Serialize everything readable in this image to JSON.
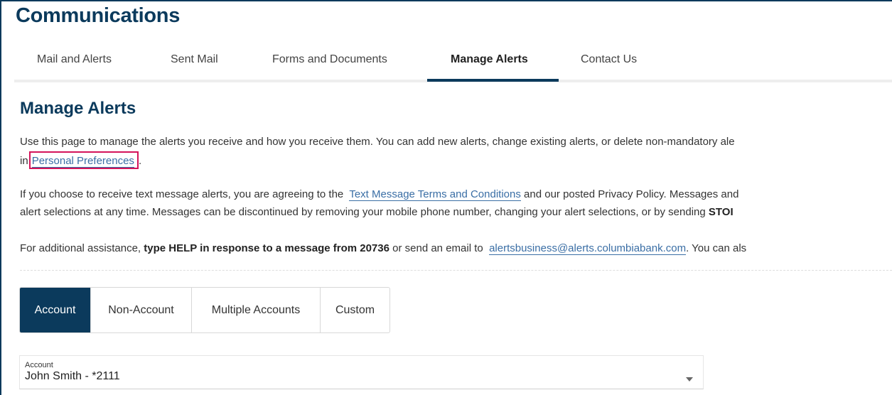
{
  "header": {
    "title": "Communications"
  },
  "tabs": [
    {
      "label": "Mail and Alerts"
    },
    {
      "label": "Sent Mail"
    },
    {
      "label": "Forms and Documents"
    },
    {
      "label": "Manage Alerts"
    },
    {
      "label": "Contact Us"
    }
  ],
  "active_tab": "Manage Alerts",
  "page": {
    "title": "Manage Alerts",
    "intro": "Use this page to manage the alerts you receive and how you receive them. You can add new alerts, change existing alerts, or delete non-mandatory ale",
    "intro_prefix": "in",
    "personal_preferences_link": "Personal Preferences",
    "intro_suffix": ".",
    "sms_pre": "If you choose to receive text message alerts, you are agreeing to the",
    "sms_terms_link": "Text Message Terms and Conditions",
    "sms_post": "and our posted Privacy Policy. Messages and",
    "sms_line2": "alert selections at any time. Messages can be discontinued by removing your mobile phone number, changing your alert selections, or by sending",
    "sms_line2_bold": "STOI",
    "help_pre": "For additional assistance,",
    "help_bold": "type HELP in response to a message from 20736",
    "help_mid": "or send an email to",
    "help_email": "alertsbusiness@alerts.columbiabank.com",
    "help_post": ". You can als"
  },
  "alert_types": [
    {
      "label": "Account"
    },
    {
      "label": "Non-Account"
    },
    {
      "label": "Multiple Accounts"
    },
    {
      "label": "Custom"
    }
  ],
  "account_select": {
    "label": "Account",
    "value": "John Smith - *2111"
  },
  "colors": {
    "brand": "#0b3a5c",
    "link": "#3a6ea5",
    "highlight": "#d4145a"
  }
}
